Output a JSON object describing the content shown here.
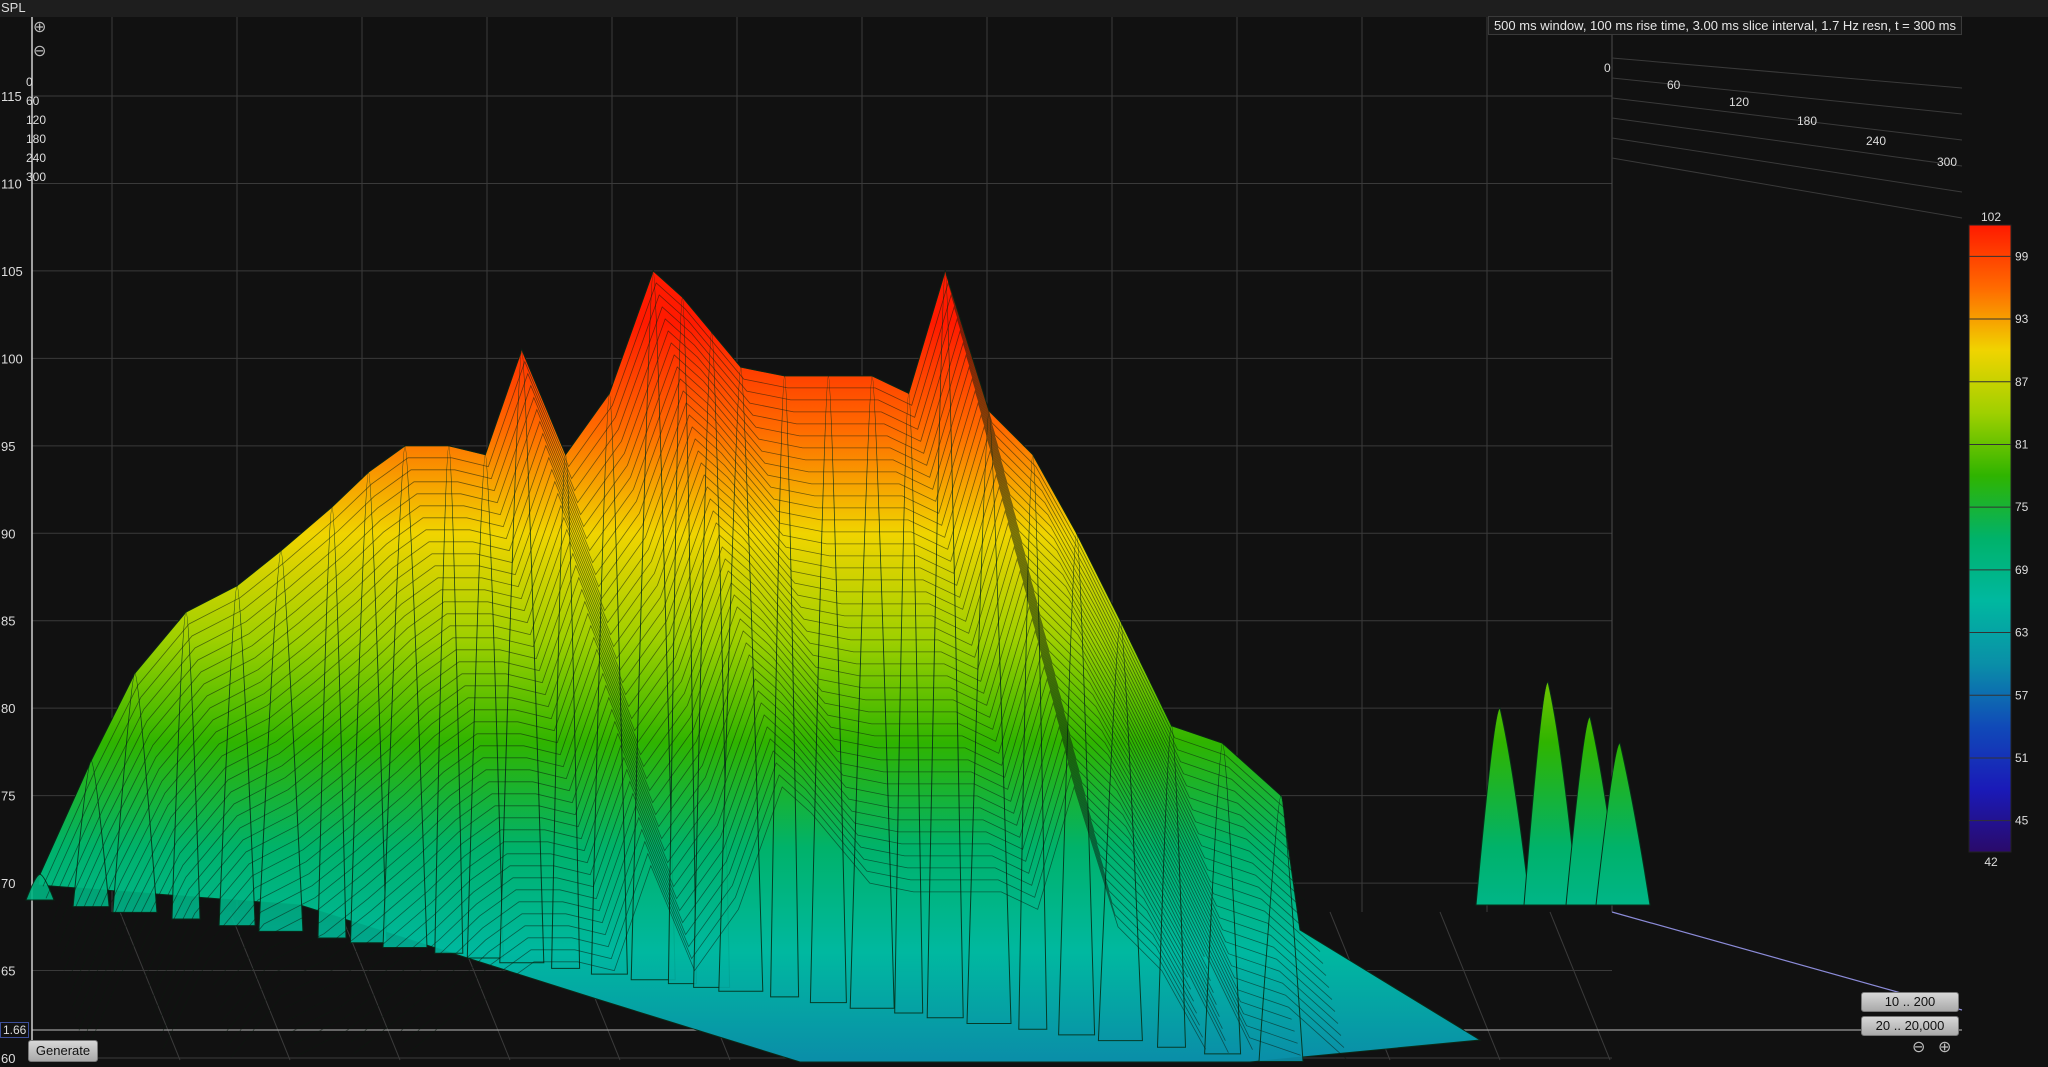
{
  "header": {
    "y_axis_title": "SPL",
    "info": "500 ms window, 100 ms rise time, 3.00 ms slice interval, 1.7 Hz resn, t = 300 ms"
  },
  "controls": {
    "generate_label": "Generate",
    "freq_range_small": "10 .. 200",
    "freq_range_full": "20 .. 20,000",
    "edge_value": "1.66"
  },
  "icons": {
    "zoom_in": "zoom-in-icon",
    "zoom_out": "zoom-out-icon"
  },
  "colors": {
    "background": "#111111",
    "grid": "#3a3a3a",
    "mesh_line": "#0c1a10"
  },
  "chart_data": {
    "type": "waterfall",
    "y_axis": {
      "label": "SPL",
      "range": [
        60,
        115
      ],
      "ticks": [
        60,
        65,
        70,
        75,
        80,
        85,
        90,
        95,
        100,
        105,
        110,
        115
      ]
    },
    "time_axis": {
      "unit": "ms",
      "ticks": [
        0,
        60,
        120,
        180,
        240,
        300
      ]
    },
    "colorbar": {
      "range": [
        42,
        102
      ],
      "ticks": [
        102,
        99,
        93,
        87,
        81,
        75,
        69,
        63,
        57,
        51,
        45,
        42
      ],
      "stops": [
        {
          "v": 102,
          "c": "#ff1a00"
        },
        {
          "v": 96,
          "c": "#ff6a00"
        },
        {
          "v": 90,
          "c": "#f0d400"
        },
        {
          "v": 84,
          "c": "#9fd000"
        },
        {
          "v": 78,
          "c": "#2fb400"
        },
        {
          "v": 72,
          "c": "#00b26a"
        },
        {
          "v": 66,
          "c": "#00b8a0"
        },
        {
          "v": 60,
          "c": "#0a8fa8"
        },
        {
          "v": 54,
          "c": "#104ab8"
        },
        {
          "v": 48,
          "c": "#1a1ab8"
        },
        {
          "v": 42,
          "c": "#2a0a6a"
        }
      ]
    },
    "peaks": [
      {
        "pos": 0.0,
        "spl": 70.5
      },
      {
        "pos": 0.07,
        "spl": 77
      },
      {
        "pos": 0.13,
        "spl": 82
      },
      {
        "pos": 0.2,
        "spl": 85.5
      },
      {
        "pos": 0.27,
        "spl": 87
      },
      {
        "pos": 0.33,
        "spl": 89
      },
      {
        "pos": 0.4,
        "spl": 91.5
      },
      {
        "pos": 0.45,
        "spl": 93.5
      },
      {
        "pos": 0.5,
        "spl": 95
      },
      {
        "pos": 0.56,
        "spl": 95
      },
      {
        "pos": 0.61,
        "spl": 94.5
      },
      {
        "pos": 0.66,
        "spl": 100.5
      },
      {
        "pos": 0.72,
        "spl": 94.5
      },
      {
        "pos": 0.78,
        "spl": 98
      },
      {
        "pos": 0.84,
        "spl": 105
      },
      {
        "pos": 0.88,
        "spl": 103.5
      },
      {
        "pos": 0.92,
        "spl": 101.5
      },
      {
        "pos": 0.96,
        "spl": 99.5
      },
      {
        "pos": 1.02,
        "spl": 99
      },
      {
        "pos": 1.08,
        "spl": 99
      },
      {
        "pos": 1.14,
        "spl": 99
      },
      {
        "pos": 1.19,
        "spl": 98
      },
      {
        "pos": 1.24,
        "spl": 105
      },
      {
        "pos": 1.3,
        "spl": 97
      },
      {
        "pos": 1.36,
        "spl": 94.5
      },
      {
        "pos": 1.42,
        "spl": 90
      },
      {
        "pos": 1.48,
        "spl": 85
      },
      {
        "pos": 1.55,
        "spl": 79
      },
      {
        "pos": 1.62,
        "spl": 78
      },
      {
        "pos": 1.7,
        "spl": 75
      }
    ]
  }
}
